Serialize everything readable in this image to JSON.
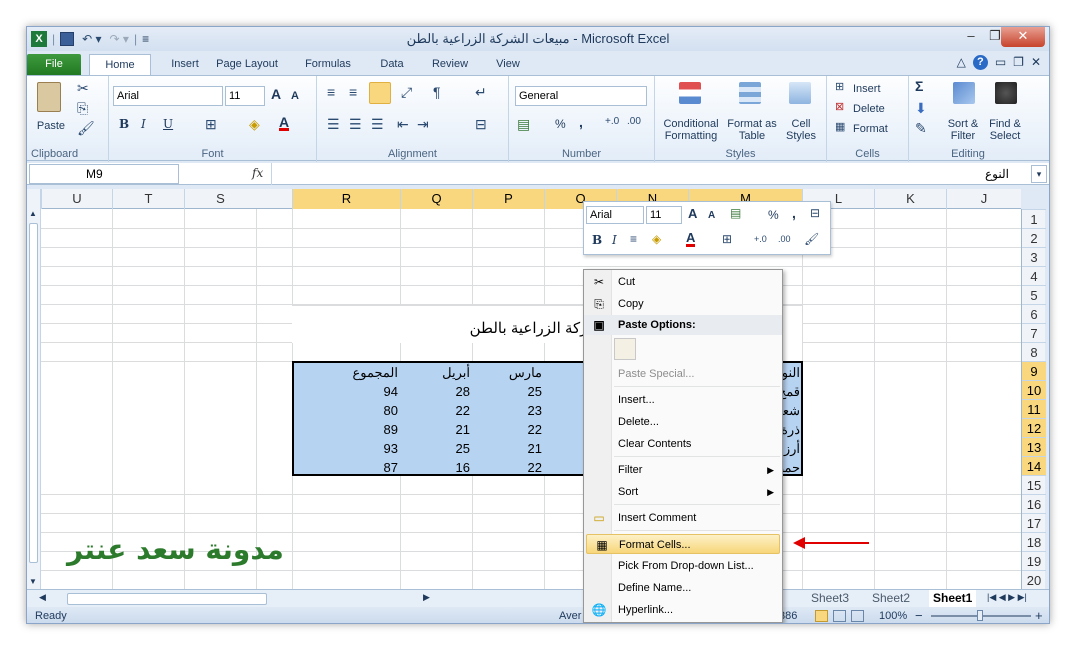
{
  "window": {
    "title": "مبيعات الشركة الزراعية بالطن - Microsoft Excel",
    "minimize": "–",
    "restore": "❐",
    "close": "✕"
  },
  "tabs": [
    "File",
    "Home",
    "Insert",
    "Page Layout",
    "Formulas",
    "Data",
    "Review",
    "View"
  ],
  "ribbon": {
    "clipboard": {
      "label": "Clipboard",
      "paste": "Paste"
    },
    "font": {
      "label": "Font",
      "name": "Arial",
      "size": "11",
      "bold": "B",
      "italic": "I",
      "underline": "U",
      "grow": "A",
      "shrink": "A",
      "color": "A"
    },
    "alignment": {
      "label": "Alignment"
    },
    "number": {
      "label": "Number",
      "format": "General",
      "percent": "%",
      "comma": ","
    },
    "styles": {
      "label": "Styles",
      "conditional": "Conditional Formatting",
      "table": "Format as Table",
      "cell": "Cell Styles"
    },
    "cells": {
      "label": "Cells",
      "insert": "Insert",
      "delete": "Delete",
      "format": "Format"
    },
    "editing": {
      "label": "Editing",
      "sigma": "Σ",
      "sort": "Sort & Filter",
      "find": "Find & Select"
    }
  },
  "formula_bar": {
    "name_box": "M9",
    "fx": "fx",
    "content": "النوع"
  },
  "grid": {
    "columns": [
      "U",
      "T",
      "S",
      "R",
      "Q",
      "P",
      "O",
      "N",
      "M",
      "L",
      "K",
      "J"
    ],
    "rows": [
      "1",
      "2",
      "3",
      "4",
      "5",
      "6",
      "7",
      "8",
      "9",
      "10",
      "11",
      "12",
      "13",
      "14",
      "15",
      "16",
      "17",
      "18",
      "19",
      "20"
    ],
    "sheet_title": "شركة الزراعية بالطن",
    "headers": {
      "total": "المجموع",
      "april": "أبريل",
      "march": "مارس",
      "type": "النو"
    },
    "table": [
      {
        "total": "94",
        "april": "28",
        "march": "25",
        "type": "قمح"
      },
      {
        "total": "80",
        "april": "22",
        "march": "23",
        "type": "شعي"
      },
      {
        "total": "89",
        "april": "21",
        "march": "22",
        "type": "ذرة"
      },
      {
        "total": "93",
        "april": "25",
        "march": "21",
        "type": "أرز"
      },
      {
        "total": "87",
        "april": "16",
        "march": "22",
        "type": "حمص"
      }
    ]
  },
  "mini_toolbar": {
    "font": "Arial",
    "size": "11",
    "percent": "%",
    "comma": ","
  },
  "context_menu": [
    {
      "label": "Cut",
      "icon": "scissors-icon",
      "state": "normal"
    },
    {
      "label": "Copy",
      "icon": "copy-icon",
      "state": "normal"
    },
    {
      "label": "Paste Options:",
      "icon": "paste-icon",
      "state": "header"
    },
    {
      "label": "Paste Special...",
      "icon": "",
      "state": "disabled"
    },
    {
      "label": "Insert...",
      "icon": "",
      "state": "normal"
    },
    {
      "label": "Delete...",
      "icon": "",
      "state": "normal"
    },
    {
      "label": "Clear Contents",
      "icon": "",
      "state": "normal"
    },
    {
      "label": "Filter",
      "icon": "",
      "state": "submenu"
    },
    {
      "label": "Sort",
      "icon": "",
      "state": "submenu"
    },
    {
      "label": "Insert Comment",
      "icon": "comment-icon",
      "state": "normal"
    },
    {
      "label": "Format Cells...",
      "icon": "format-cells-icon",
      "state": "highlighted"
    },
    {
      "label": "Pick From Drop-down List...",
      "icon": "",
      "state": "normal"
    },
    {
      "label": "Define Name...",
      "icon": "",
      "state": "normal"
    },
    {
      "label": "Hyperlink...",
      "icon": "hyperlink-icon",
      "state": "normal"
    }
  ],
  "sheets": [
    "Sheet3",
    "Sheet2",
    "Sheet1"
  ],
  "status": {
    "ready": "Ready",
    "average": "Aver",
    "count": "386",
    "zoom": "100%",
    "minus": "−",
    "plus": "+"
  },
  "watermark": "مدونة سعد عنتر",
  "colors": {
    "selection": "#b7d3f2",
    "highlight": "#f9d77e",
    "accent": "#217a21",
    "arrow": "#e00000"
  }
}
